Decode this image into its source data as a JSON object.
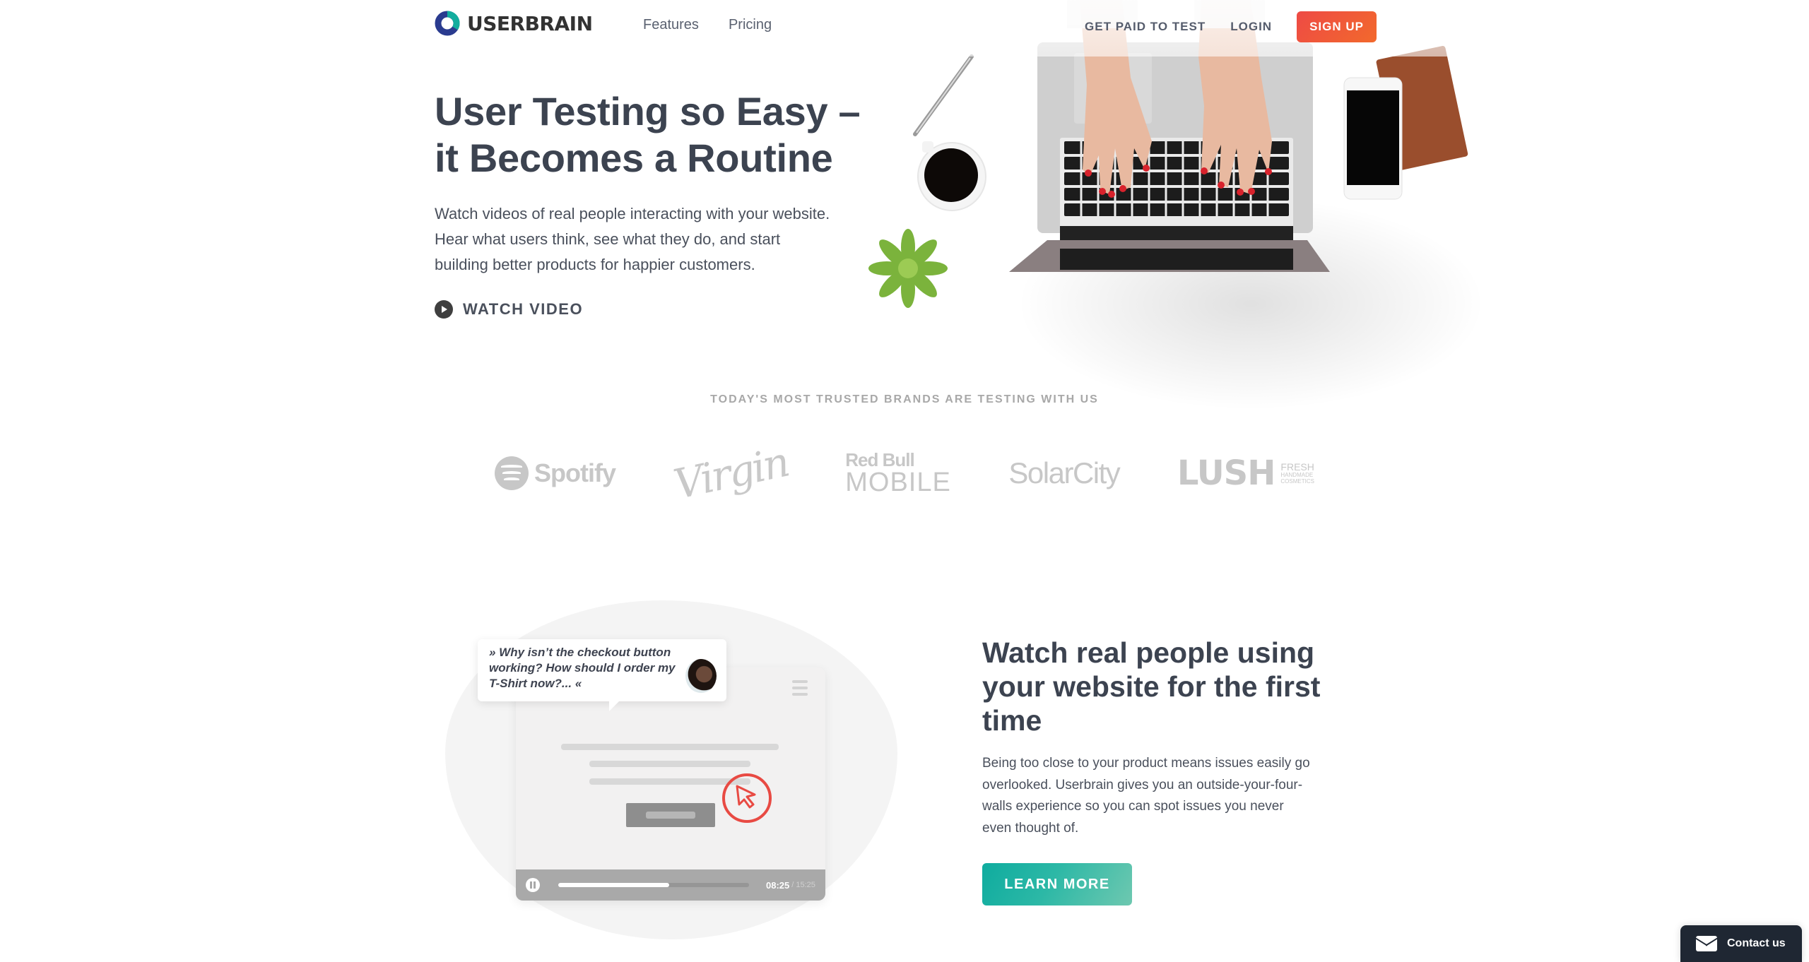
{
  "brand": {
    "name": "USERBRAIN",
    "colors": {
      "teal": "#12ad9e",
      "navy": "#2a3b8f"
    }
  },
  "nav": {
    "links": [
      {
        "label": "Features"
      },
      {
        "label": "Pricing"
      }
    ],
    "get_paid_label": "GET PAID TO TEST",
    "login_label": "LOGIN",
    "signup_label": "SIGN UP"
  },
  "hero": {
    "title": "User Testing so Easy – it Becomes a Routine",
    "description": "Watch videos of real people interacting with your website. Hear what users think, see what they do, and start building better products for happier customers.",
    "watch_video_label": "WATCH VIDEO",
    "image_alt": "Hands typing on laptop with coffee, plant, pen and phone on a desk"
  },
  "brands": {
    "heading": "TODAY'S MOST TRUSTED BRANDS ARE TESTING WITH US",
    "logos": [
      {
        "name": "Spotify",
        "text": "Spotify"
      },
      {
        "name": "Virgin",
        "text": "Virgin"
      },
      {
        "name": "Red Bull Mobile",
        "top": "Red Bull",
        "bottom": "MOBILE"
      },
      {
        "name": "SolarCity",
        "text": "SolarCity"
      },
      {
        "name": "Lush",
        "text": "LUSH",
        "sub1": "FRESH",
        "sub2": "HANDMADE",
        "sub3": "COSMETICS"
      }
    ]
  },
  "feature": {
    "title": "Watch real people using your website for the first time",
    "description": "Being too close to your product means issues easily go overlooked. Userbrain gives you an outside-your-four-walls experience so you can spot issues you never even thought of.",
    "learn_more_label": "LEARN MORE",
    "illustration": {
      "quote": "» Why isn’t the checkout button working? How should I order my T-Shirt now?... «",
      "time_current": "08:25",
      "time_total": "/ 15:25",
      "progress_percent": 58
    }
  },
  "contact": {
    "label": "Contact us"
  }
}
